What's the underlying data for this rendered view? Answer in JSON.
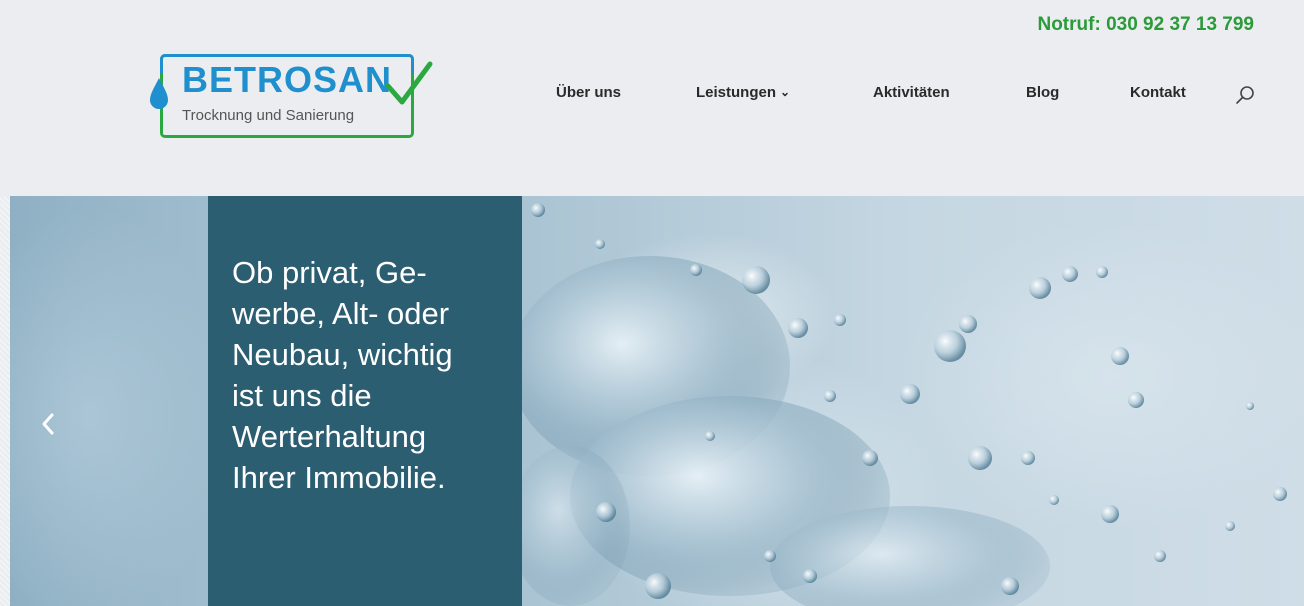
{
  "header": {
    "emergency": "Notruf: 030 92 37 13 799",
    "logo": {
      "name": "BETROSAN",
      "tagline": "Trocknung und Sanierung"
    }
  },
  "nav": {
    "items": [
      {
        "label": "Über uns"
      },
      {
        "label": "Leistungen",
        "chevron": "chevron-down-icon"
      },
      {
        "label": "Aktivitäten"
      },
      {
        "label": "Blog"
      },
      {
        "label": "Kontakt"
      }
    ],
    "search_icon": "search-icon"
  },
  "hero": {
    "headline": "Ob privat, Ge-werbe, Alt- oder Neubau, wichtig ist uns die Werterhaltung Ihrer Immobilie.",
    "lines": [
      "Ob privat, Ge-",
      "werbe, Alt- oder",
      "Neubau, wichtig",
      "ist uns die",
      "Werterhaltung",
      "Ihrer Immobilie."
    ],
    "prev_icon": "chevron-left-icon"
  },
  "colors": {
    "emergency": "#2b9b3a",
    "brand_blue": "#1f8fce",
    "brand_green": "#2ba840",
    "hero_box": "#2c5e72"
  }
}
